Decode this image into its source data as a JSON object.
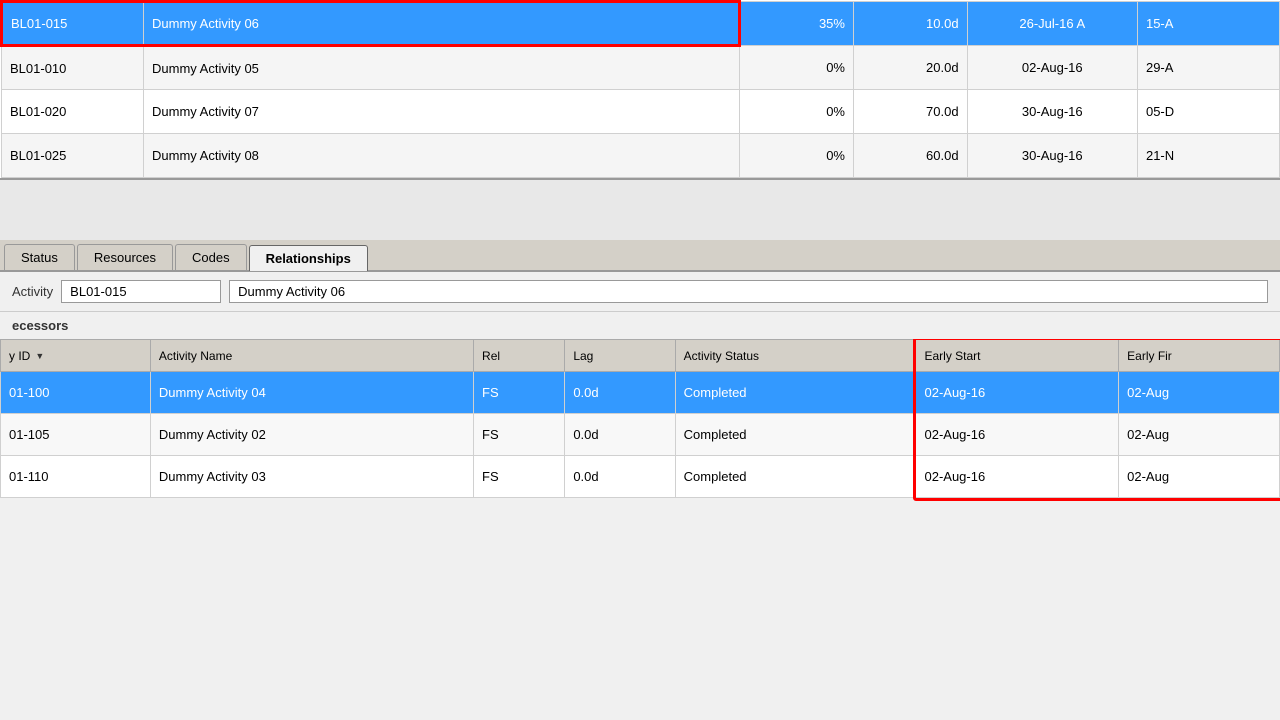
{
  "top_table": {
    "rows": [
      {
        "id": "BL01-015",
        "name": "Dummy Activity 06",
        "pct": "35%",
        "dur": "10.0d",
        "start": "26-Jul-16 A",
        "finish": "15-A",
        "selected": true,
        "red_outline": true
      },
      {
        "id": "BL01-010",
        "name": "Dummy Activity 05",
        "pct": "0%",
        "dur": "20.0d",
        "start": "02-Aug-16",
        "finish": "29-A",
        "selected": false,
        "red_outline": false
      },
      {
        "id": "BL01-020",
        "name": "Dummy Activity 07",
        "pct": "0%",
        "dur": "70.0d",
        "start": "30-Aug-16",
        "finish": "05-D",
        "selected": false,
        "red_outline": false
      },
      {
        "id": "BL01-025",
        "name": "Dummy Activity 08",
        "pct": "0%",
        "dur": "60.0d",
        "start": "30-Aug-16",
        "finish": "21-N",
        "selected": false,
        "red_outline": false
      }
    ]
  },
  "tabs": {
    "items": [
      "Status",
      "Resources",
      "Codes",
      "Relationships"
    ],
    "active": "Relationships"
  },
  "activity_info": {
    "label": "Activity",
    "id_value": "BL01-015",
    "name_value": "Dummy Activity 06"
  },
  "predecessors": {
    "header": "ecessors",
    "columns": [
      "y ID",
      "Activity Name",
      "Rel",
      "Lag",
      "Activity Status",
      "Early Start",
      "Early Fir"
    ],
    "rows": [
      {
        "id": "01-100",
        "name": "Dummy Activity 04",
        "rel": "FS",
        "lag": "0.0d",
        "status": "Completed",
        "early_start": "02-Aug-16",
        "early_finish": "02-Aug",
        "selected": true
      },
      {
        "id": "01-105",
        "name": "Dummy Activity 02",
        "rel": "FS",
        "lag": "0.0d",
        "status": "Completed",
        "early_start": "02-Aug-16",
        "early_finish": "02-Aug",
        "selected": false
      },
      {
        "id": "01-110",
        "name": "Dummy Activity 03",
        "rel": "FS",
        "lag": "0.0d",
        "status": "Completed",
        "early_start": "02-Aug-16",
        "early_finish": "02-Aug",
        "selected": false
      }
    ]
  },
  "colors": {
    "selected_blue": "#3399ff",
    "red_outline": "#ff0000",
    "tab_bg": "#d4d0c8",
    "header_bg": "#d4d0c8"
  }
}
